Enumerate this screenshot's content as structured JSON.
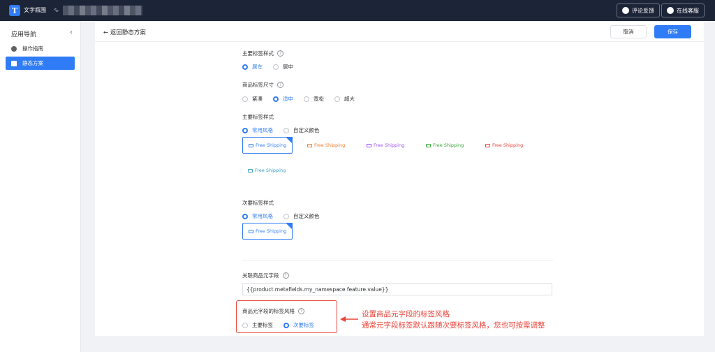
{
  "topbar": {
    "logo_letter": "T",
    "app_name": "文字瓶围",
    "feedback_label": "评论反馈",
    "support_label": "在线客服"
  },
  "sidebar": {
    "title": "应用导航",
    "collapse": "‹",
    "items": [
      {
        "label": "操作指南",
        "active": false
      },
      {
        "label": "静态方案",
        "active": true
      }
    ]
  },
  "header": {
    "back_label": "← 返回静态方案",
    "cancel_label": "取消",
    "save_label": "保存"
  },
  "primary_tag_position": {
    "label": "主要标签样式",
    "options": [
      "居左",
      "居中"
    ],
    "selected": "居左"
  },
  "tag_size": {
    "label": "商品标签尺寸",
    "options": [
      "紧凑",
      "适中",
      "宽松",
      "超大"
    ],
    "selected": "适中"
  },
  "primary_tag_style": {
    "label": "主要标签样式",
    "options": [
      "常用风格",
      "自定义颜色"
    ],
    "selected": "常用风格",
    "tags": [
      {
        "text": "Free Shipping",
        "color": "#2f7cf6",
        "selected": true
      },
      {
        "text": "Free Shipping",
        "color": "#f07a2a",
        "selected": false
      },
      {
        "text": "Free Shipping",
        "color": "#9b4ff0",
        "selected": false
      },
      {
        "text": "Free Shipping",
        "color": "#3aa83a",
        "selected": false
      },
      {
        "text": "Free Shipping",
        "color": "#e8443a",
        "selected": false
      },
      {
        "text": "Free Shipping",
        "color": "#3aa0c8",
        "selected": false
      }
    ]
  },
  "secondary_tag_style": {
    "label": "次要标签样式",
    "options": [
      "常用风格",
      "自定义颜色"
    ],
    "selected": "常用风格",
    "tag": {
      "text": "Free Shipping",
      "color": "#2f7cf6"
    }
  },
  "metafield": {
    "label": "关联商品元字段",
    "value": "{{product.metafields.my_namespace.feature.value}}"
  },
  "metafield_tag_style": {
    "label": "商品元字段的标签风格",
    "options": [
      "主要标签",
      "次要标签"
    ],
    "selected": "次要标签"
  },
  "annotation": {
    "line1": "设置商品元字段的标签风格",
    "line2": "通常元字段标签默认跟随次要标签风格，您也可按需调整"
  },
  "colors": {
    "accent": "#2f7cf6",
    "topbar": "#1c2437",
    "annotation_red": "#e8443a"
  }
}
